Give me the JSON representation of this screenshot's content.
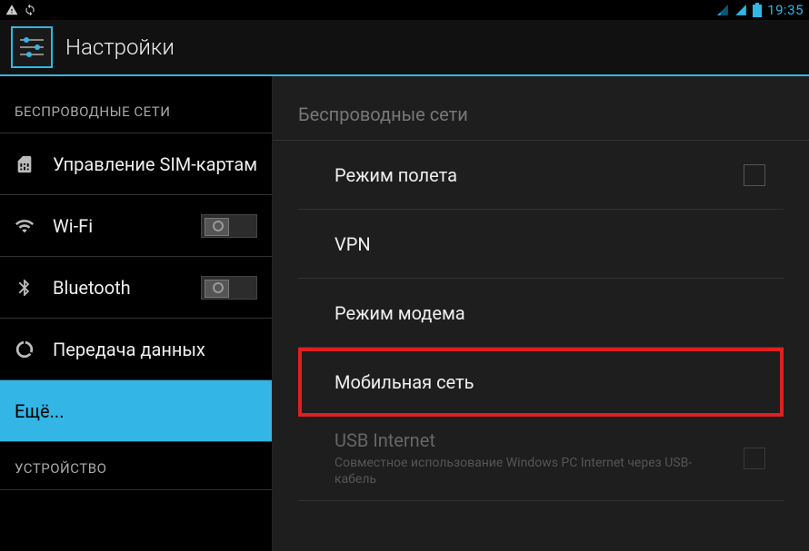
{
  "status_bar": {
    "time": "19:35"
  },
  "header": {
    "title": "Настройки"
  },
  "sidebar": {
    "category1": "БЕСПРОВОДНЫЕ СЕТИ",
    "sim": "Управление SIM-картам",
    "wifi": "Wi-Fi",
    "bluetooth": "Bluetooth",
    "data": "Передача данных",
    "more": "Ещё...",
    "category2": "УСТРОЙСТВО"
  },
  "content": {
    "header": "Беспроводные сети",
    "airplane": "Режим полета",
    "vpn": "VPN",
    "tether": "Режим модема",
    "mobile": "Мобильная сеть",
    "usb_title": "USB Internet",
    "usb_sub": "Совместное использование Windows PC Internet через USB-кабель"
  }
}
